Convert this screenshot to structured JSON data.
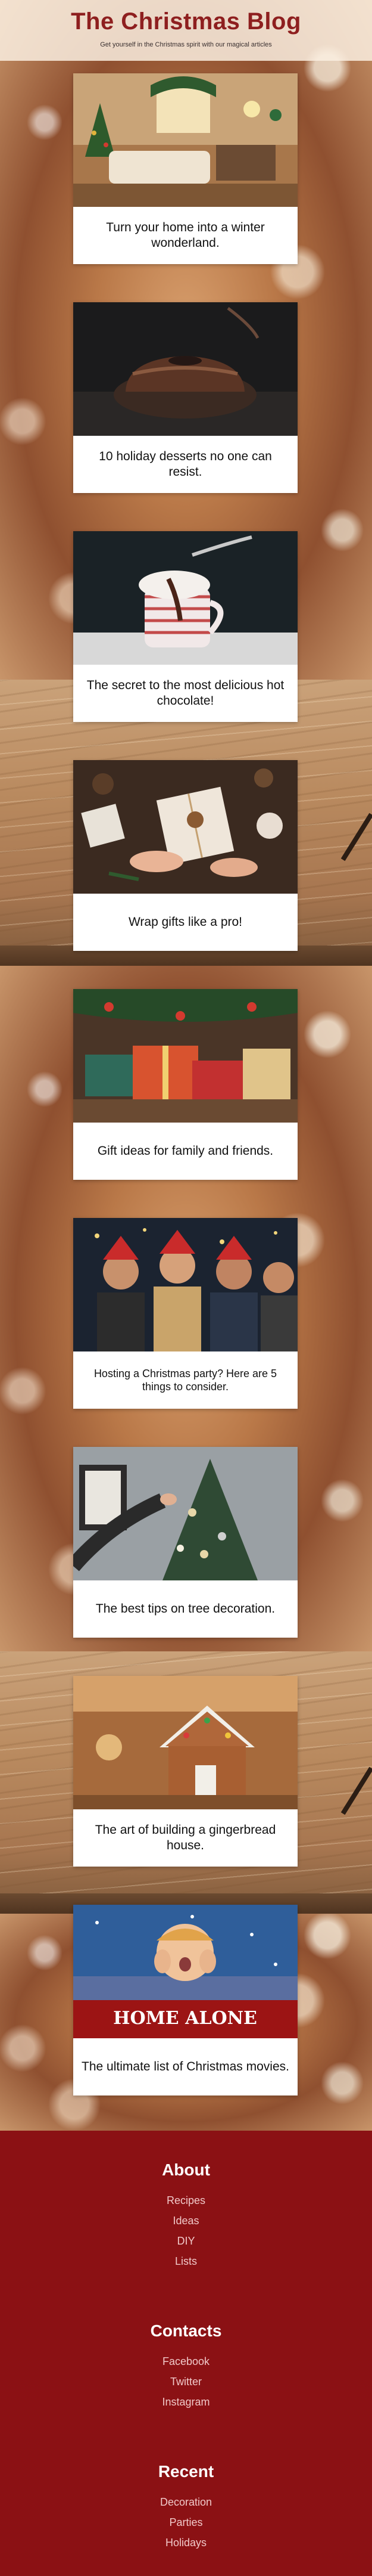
{
  "header": {
    "title": "The Christmas Blog",
    "tagline": "Get yourself in the Christmas spirit with our magical articles"
  },
  "posts": [
    {
      "caption": "Turn your home into a winter wonderland."
    },
    {
      "caption": "10 holiday desserts no one can resist."
    },
    {
      "caption": "The secret to the most delicious hot chocolate!"
    },
    {
      "caption": "Wrap gifts like a pro!"
    },
    {
      "caption": "Gift ideas for family and friends."
    },
    {
      "caption": "Hosting a Christmas party? Here are 5 things to consider."
    },
    {
      "caption": "The best tips on tree decoration."
    },
    {
      "caption": "The art of building a gingerbread house."
    },
    {
      "caption": "The ultimate list of Christmas movies."
    }
  ],
  "movie_poster_text": "HOME ALONE",
  "footer": {
    "about": {
      "heading": "About",
      "links": [
        "Recipes",
        "Ideas",
        "DIY",
        "Lists"
      ]
    },
    "contacts": {
      "heading": "Contacts",
      "links": [
        "Facebook",
        "Twitter",
        "Instagram"
      ]
    },
    "recent": {
      "heading": "Recent",
      "links": [
        "Decoration",
        "Parties",
        "Holidays"
      ]
    }
  },
  "colors": {
    "brand": "#8e1f1f",
    "footer_bg": "#8b1114",
    "footer_link": "#f1c9c9"
  }
}
